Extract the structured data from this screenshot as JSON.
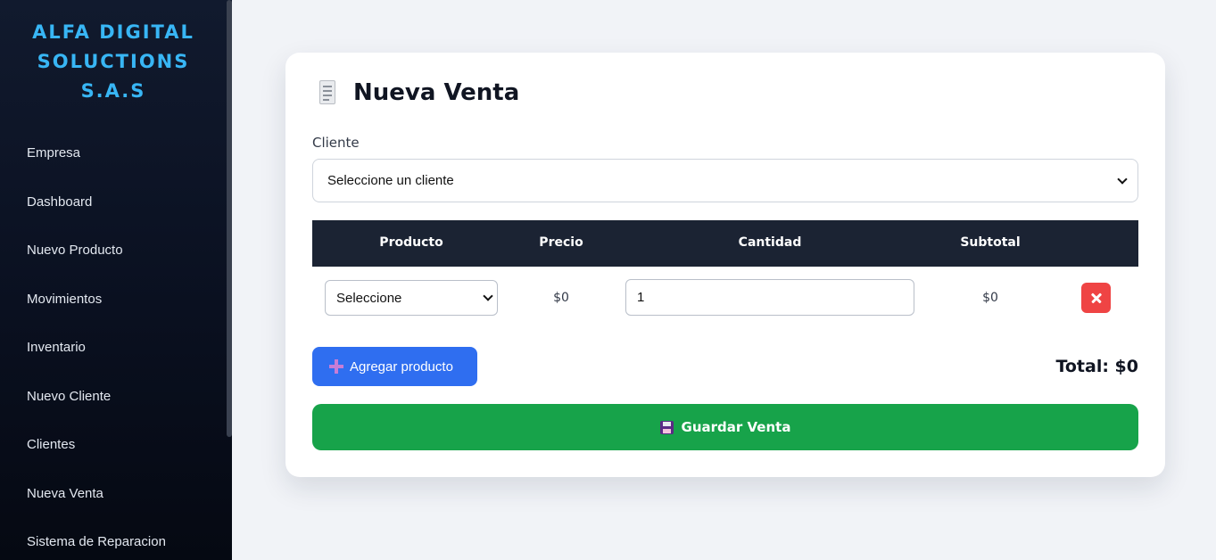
{
  "sidebar": {
    "brand_lines": [
      "ALFA DIGITAL",
      "SOLUCTIONS",
      "S.A.S"
    ],
    "items": [
      {
        "label": "Empresa"
      },
      {
        "label": "Dashboard"
      },
      {
        "label": "Nuevo Producto"
      },
      {
        "label": "Movimientos"
      },
      {
        "label": "Inventario"
      },
      {
        "label": "Nuevo Cliente"
      },
      {
        "label": "Clientes"
      },
      {
        "label": "Nueva Venta"
      },
      {
        "label": "Sistema de Reparacion"
      }
    ]
  },
  "form": {
    "title_icon": "receipt-icon",
    "title": "Nueva Venta",
    "client_label": "Cliente",
    "client_select_value": "Seleccione un cliente",
    "table": {
      "headers": [
        "Producto",
        "Precio",
        "Cantidad",
        "Subtotal"
      ],
      "rows": [
        {
          "product_select_value": "Seleccione",
          "price": "$0",
          "quantity": "1",
          "subtotal": "$0",
          "delete_icon": "close-icon"
        }
      ]
    },
    "add_product_icon": "plus-icon",
    "add_product_label": "Agregar producto",
    "total": "Total: $0",
    "save_icon": "floppy-disk-icon",
    "save_label": "Guardar Venta"
  },
  "colors": {
    "brand": "#38b6f5",
    "table_header": "#1b2333",
    "add_button": "#2f6ef0",
    "save_button": "#17a34a",
    "delete_button": "#ef4444"
  }
}
